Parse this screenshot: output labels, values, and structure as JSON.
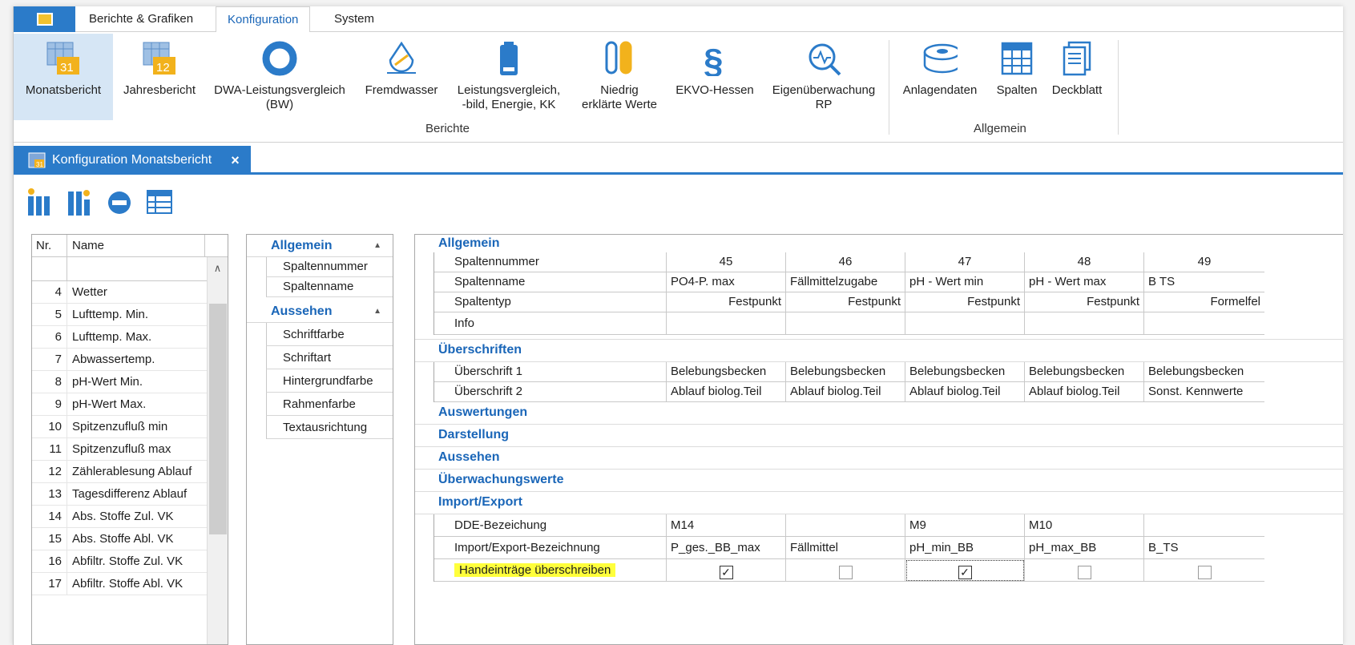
{
  "menu": {
    "tabs": [
      "Berichte & Grafiken",
      "Konfiguration",
      "System"
    ],
    "active": "Konfiguration"
  },
  "ribbon": {
    "berichte": [
      {
        "label": "Monatsbericht",
        "icon": "calendar-31-icon"
      },
      {
        "label": "Jahresbericht",
        "icon": "calendar-12-icon"
      },
      {
        "label": "DWA-Leistungsvergleich\n(BW)",
        "icon": "ring-icon"
      },
      {
        "label": "Fremdwasser",
        "icon": "water-drop-icon"
      },
      {
        "label": "Leistungsvergleich,\n-bild, Energie, KK",
        "icon": "battery-icon"
      },
      {
        "label": "Niedrig\nerklärte Werte",
        "icon": "test-tubes-icon"
      },
      {
        "label": "EKVO-Hessen",
        "icon": "paragraph-icon"
      },
      {
        "label": "Eigenüberwachung\nRP",
        "icon": "magnifier-wave-icon"
      }
    ],
    "berichte_group": "Berichte",
    "allgemein": [
      {
        "label": "Anlagendaten",
        "icon": "tank-icon"
      },
      {
        "label": "Spalten",
        "icon": "grid-icon"
      },
      {
        "label": "Deckblatt",
        "icon": "pages-icon"
      }
    ],
    "allgemein_group": "Allgemein"
  },
  "doc_tab": {
    "label": "Konfiguration Monatsbericht",
    "close": "×"
  },
  "list": {
    "headers": {
      "nr": "Nr.",
      "name": "Name"
    },
    "rows": [
      {
        "nr": "4",
        "name": "Wetter"
      },
      {
        "nr": "5",
        "name": "Lufttemp. Min."
      },
      {
        "nr": "6",
        "name": "Lufttemp. Max."
      },
      {
        "nr": "7",
        "name": "Abwassertemp."
      },
      {
        "nr": "8",
        "name": "pH-Wert Min."
      },
      {
        "nr": "9",
        "name": "pH-Wert Max."
      },
      {
        "nr": "10",
        "name": "Spitzenzufluß min"
      },
      {
        "nr": "11",
        "name": "Spitzenzufluß max"
      },
      {
        "nr": "12",
        "name": "Zählerablesung Ablauf"
      },
      {
        "nr": "13",
        "name": "Tagesdifferenz Ablauf"
      },
      {
        "nr": "14",
        "name": "Abs. Stoffe Zul. VK"
      },
      {
        "nr": "15",
        "name": "Abs. Stoffe Abl. VK"
      },
      {
        "nr": "16",
        "name": "Abfiltr. Stoffe Zul. VK"
      },
      {
        "nr": "17",
        "name": "Abfiltr. Stoffe Abl. VK"
      }
    ]
  },
  "categories": {
    "allgemein": {
      "title": "Allgemein",
      "items": [
        "Spaltennummer",
        "Spaltenname"
      ]
    },
    "aussehen": {
      "title": "Aussehen",
      "items": [
        "Schriftfarbe",
        "Schriftart",
        "Hintergrundfarbe",
        "Rahmenfarbe",
        "Textausrichtung"
      ]
    }
  },
  "grid": {
    "sections": {
      "allgemein": "Allgemein",
      "ueberschriften": "Überschriften",
      "auswertungen": "Auswertungen",
      "darstellung": "Darstellung",
      "aussehen": "Aussehen",
      "ueberwachung": "Überwachungswerte",
      "import": "Import/Export"
    },
    "labels": {
      "spaltennummer": "Spaltennummer",
      "spaltenname": "Spaltenname",
      "spaltentyp": "Spaltentyp",
      "info": "Info",
      "ueberschrift1": "Überschrift 1",
      "ueberschrift2": "Überschrift 2",
      "dde": "DDE-Bezeichung",
      "ie": "Import/Export-Bezeichnung",
      "hand": "Handeinträge überschreiben"
    },
    "columns": [
      {
        "nr": "45",
        "name": "PO4-P. max",
        "typ": "Festpunkt",
        "info": "",
        "u1": "Belebungsbecken",
        "u2": "Ablauf biolog.Teil",
        "dde": "M14",
        "ie": "P_ges._BB_max",
        "hand": true
      },
      {
        "nr": "46",
        "name": "Fällmittelzugabe",
        "typ": "Festpunkt",
        "info": "",
        "u1": "Belebungsbecken",
        "u2": "Ablauf biolog.Teil",
        "dde": "",
        "ie": "Fällmittel",
        "hand": false
      },
      {
        "nr": "47",
        "name": "pH - Wert min",
        "typ": "Festpunkt",
        "info": "",
        "u1": "Belebungsbecken",
        "u2": "Ablauf biolog.Teil",
        "dde": "M9",
        "ie": "pH_min_BB",
        "hand": true
      },
      {
        "nr": "48",
        "name": "pH - Wert max",
        "typ": "Festpunkt",
        "info": "",
        "u1": "Belebungsbecken",
        "u2": "Ablauf biolog.Teil",
        "dde": "M10",
        "ie": "pH_max_BB",
        "hand": false
      },
      {
        "nr": "49",
        "name": "B TS",
        "typ": "Formelfel",
        "info": "",
        "u1": "Belebungsbecken",
        "u2": "Sonst. Kennwerte",
        "dde": "",
        "ie": "B_TS",
        "hand": false
      }
    ]
  },
  "colors": {
    "accent": "#2b7bc9",
    "section": "#1a66b8",
    "highlight": "#ffff3c",
    "selected": "#d6e6f5"
  }
}
